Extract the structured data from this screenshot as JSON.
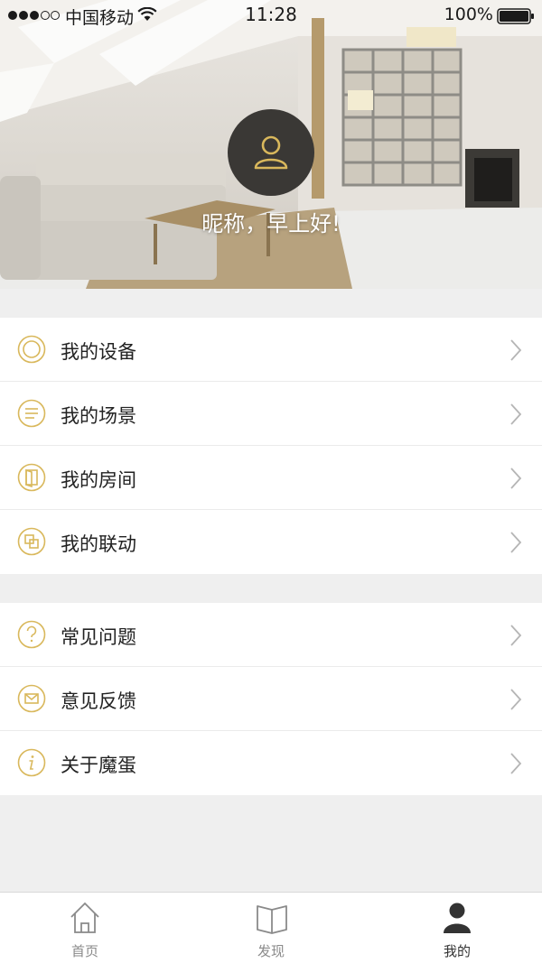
{
  "status_bar": {
    "carrier": "中国移动",
    "time": "11:28",
    "battery": "100%"
  },
  "profile": {
    "greeting": "昵称，早上好!"
  },
  "menu_group_1": [
    {
      "label": "我的设备",
      "icon": "device-ring-icon"
    },
    {
      "label": "我的场景",
      "icon": "scene-lines-icon"
    },
    {
      "label": "我的房间",
      "icon": "room-door-icon"
    },
    {
      "label": "我的联动",
      "icon": "linkage-squares-icon"
    }
  ],
  "menu_group_2": [
    {
      "label": "常见问题",
      "icon": "question-icon"
    },
    {
      "label": "意见反馈",
      "icon": "feedback-mail-icon"
    },
    {
      "label": "关于魔蛋",
      "icon": "info-icon"
    }
  ],
  "tabbar": {
    "home": "首页",
    "discover": "发现",
    "mine": "我的"
  },
  "colors": {
    "accent_gold": "#d9b85c",
    "avatar_bg": "#3a3835",
    "text": "#222222",
    "tab_inactive": "#8a8a8a"
  }
}
